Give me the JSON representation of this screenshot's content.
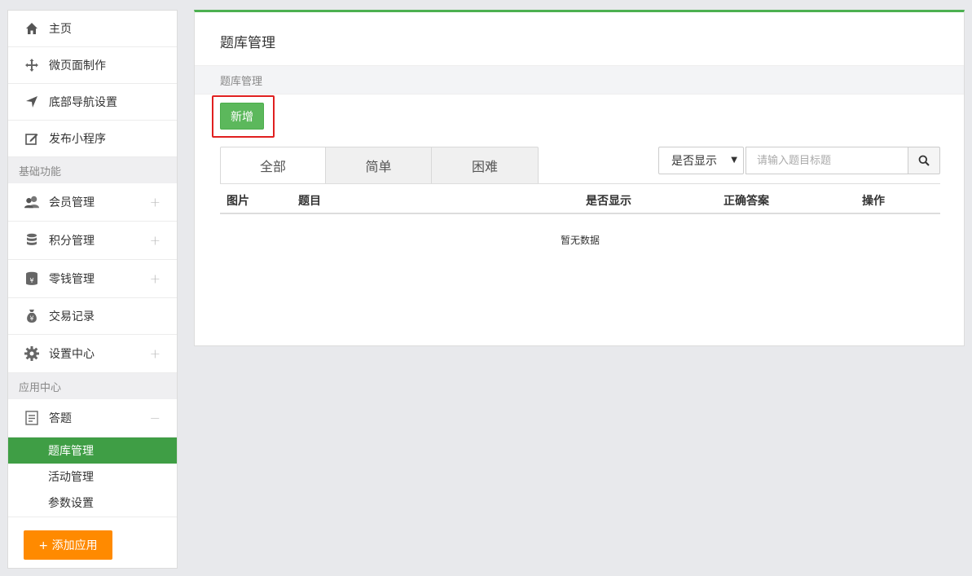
{
  "sidebar": {
    "items": [
      {
        "label": "主页"
      },
      {
        "label": "微页面制作"
      },
      {
        "label": "底部导航设置"
      },
      {
        "label": "发布小程序"
      }
    ],
    "section_basic": "基础功能",
    "basic_items": [
      {
        "label": "会员管理",
        "expander": "+"
      },
      {
        "label": "积分管理",
        "expander": "+"
      },
      {
        "label": "零钱管理",
        "expander": "+"
      },
      {
        "label": "交易记录"
      },
      {
        "label": "设置中心",
        "expander": "+"
      }
    ],
    "section_apps": "应用中心",
    "app_item": {
      "label": "答题",
      "expander": "−"
    },
    "sub_items": [
      {
        "label": "题库管理",
        "active": true
      },
      {
        "label": "活动管理"
      },
      {
        "label": "参数设置"
      }
    ],
    "add_app_label": "+ 添加应用",
    "colors": {
      "active": "#3f9e45",
      "add_button": "#ff8a00"
    }
  },
  "main": {
    "title": "题库管理",
    "breadcrumb": "题库管理",
    "new_button": "新增",
    "tabs": [
      "全部",
      "简单",
      "困难"
    ],
    "filter_select": "是否显示",
    "search_placeholder": "请输入题目标题",
    "table_headers": [
      "图片",
      "题目",
      "是否显示",
      "正确答案",
      "操作"
    ],
    "empty_text": "暂无数据",
    "colors": {
      "accent": "#4cb050",
      "new_button": "#5cb85c",
      "highlight": "#e02020"
    }
  }
}
